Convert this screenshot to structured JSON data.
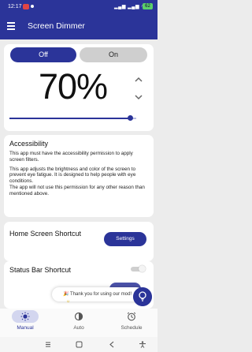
{
  "status_bar": {
    "time": "12:17",
    "battery": "62"
  },
  "app_bar": {
    "title": "Screen Dimmer",
    "menu_icon": "hamburger-menu-icon"
  },
  "dimmer": {
    "off_label": "Off",
    "on_label": "On",
    "selected": "Off",
    "level_text": "70%",
    "slider_fraction": 0.9
  },
  "accessibility": {
    "heading": "Accessibility",
    "paragraph1": "This app must have the accessibility permission to apply screen filters.",
    "paragraph2": "This app adjusts the brightness and color of the screen to prevent eye fatigue. It is designed to help people with eye conditions.",
    "paragraph3": "The app will not use this permission for any other reason than mentioned above."
  },
  "home_shortcut": {
    "heading": "Home Screen Shortcut",
    "button_label": "Settings"
  },
  "status_shortcut": {
    "heading": "Status Bar Shortcut",
    "toggle_on": false
  },
  "toast": {
    "text": "Thank you for using our mod!"
  },
  "bottom_nav": {
    "items": [
      {
        "label": "Manual",
        "icon": "sun-icon",
        "active": true
      },
      {
        "label": "Auto",
        "icon": "auto-brightness-icon",
        "active": false
      },
      {
        "label": "Schedule",
        "icon": "alarm-clock-icon",
        "active": false
      }
    ]
  },
  "colors": {
    "primary": "#2b3499",
    "secondary_bg": "#cfcfcf",
    "background": "#ececec"
  }
}
